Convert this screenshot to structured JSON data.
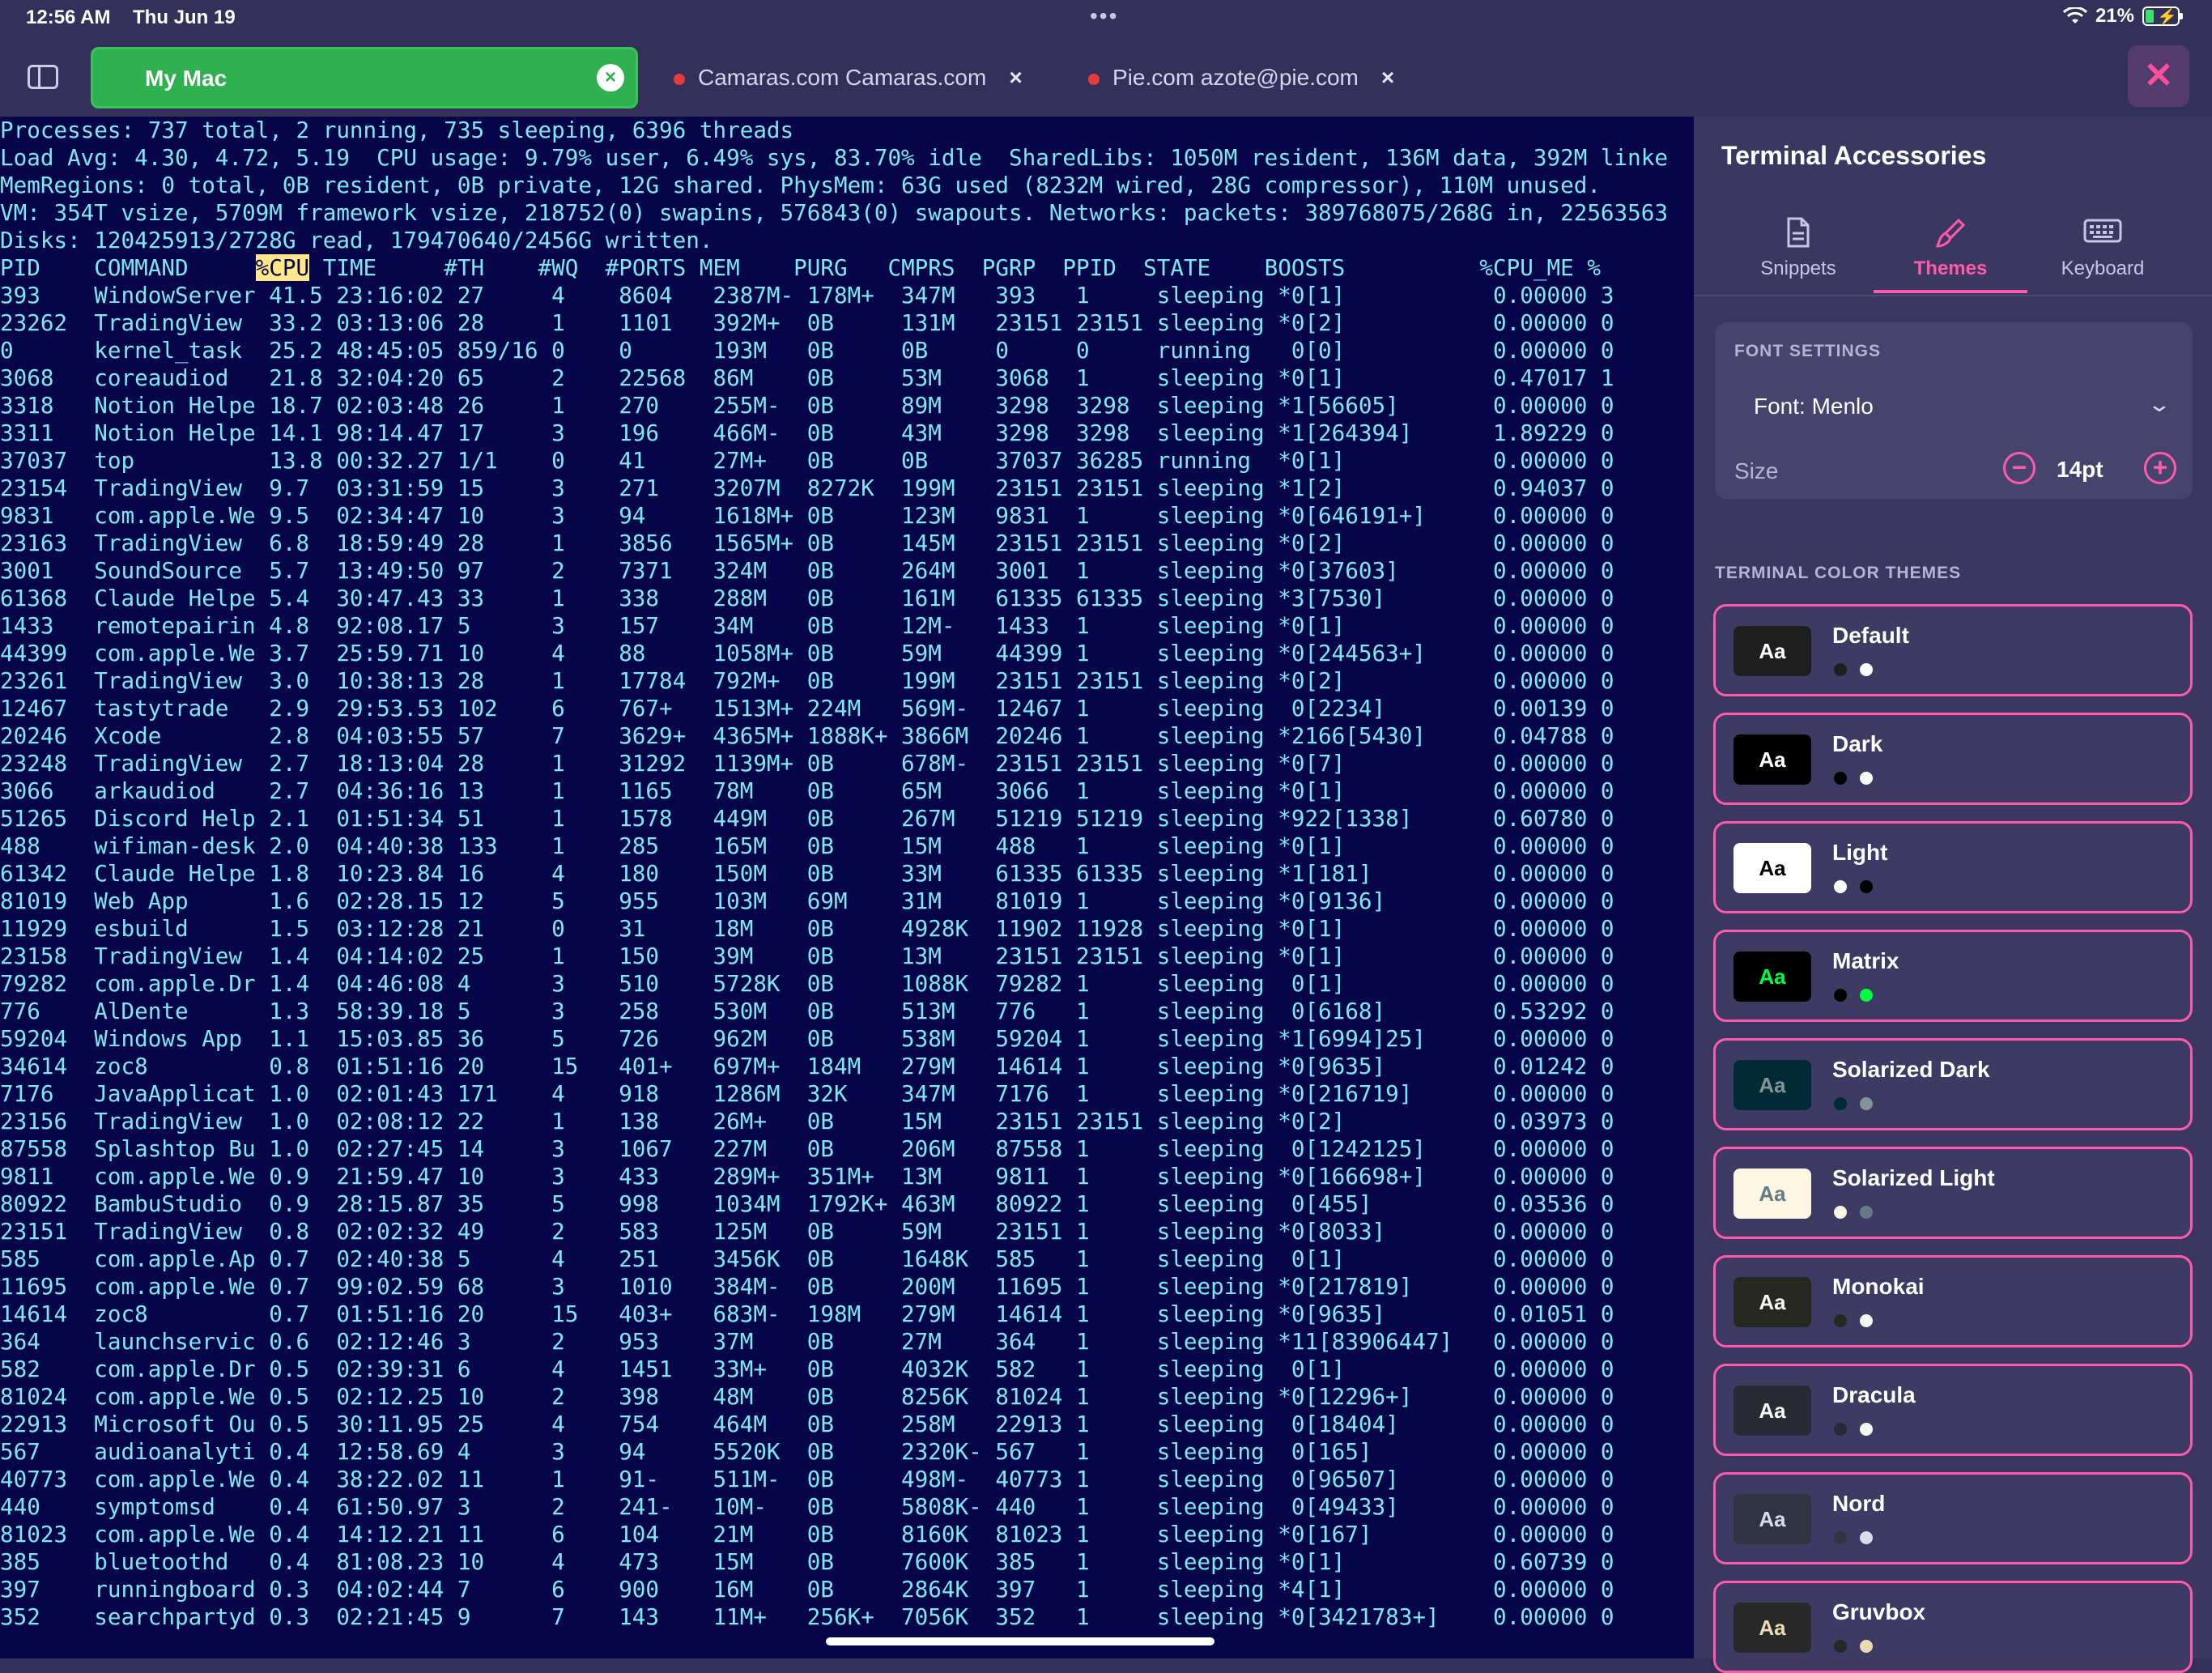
{
  "status_bar": {
    "time": "12:56 AM",
    "date": "Thu Jun 19",
    "battery": "21%",
    "menu_dots": "•••"
  },
  "tabs": {
    "active": {
      "label": "My Mac",
      "close": "×"
    },
    "others": [
      {
        "label": "Camaras.com Camaras.com",
        "close": "×"
      },
      {
        "label": "Pie.com azote@pie.com",
        "close": "×"
      }
    ],
    "close_panel": "✕"
  },
  "terminal": {
    "header": [
      "Processes: 737 total, 2 running, 735 sleeping, 6396 threads",
      "Load Avg: 4.30, 4.72, 5.19  CPU usage: 9.79% user, 6.49% sys, 83.70% idle  SharedLibs: 1050M resident, 136M data, 392M linke",
      "MemRegions: 0 total, 0B resident, 0B private, 12G shared. PhysMem: 63G used (8232M wired, 28G compressor), 110M unused.",
      "VM: 354T vsize, 5709M framework vsize, 218752(0) swapins, 576843(0) swapouts. Networks: packets: 389768075/268G in, 22563563",
      "Disks: 120425913/2728G read, 179470640/2456G written.",
      ""
    ],
    "column_prefix": "PID    COMMAND     ",
    "column_highlight": "%CPU",
    "column_suffix": " TIME     #TH    #WQ  #PORTS MEM    PURG   CMPRS  PGRP  PPID  STATE    BOOSTS          %CPU_ME %",
    "rows": [
      "393    WindowServer 41.5 23:16:02 27     4    8604   2387M- 178M+  347M   393   1     sleeping *0[1]           0.00000 3",
      "23262  TradingView  33.2 03:13:06 28     1    1101   392M+  0B     131M   23151 23151 sleeping *0[2]           0.00000 0",
      "0      kernel_task  25.2 48:45:05 859/16 0    0      193M   0B     0B     0     0     running   0[0]           0.00000 0",
      "3068   coreaudiod   21.8 32:04:20 65     2    22568  86M    0B     53M    3068  1     sleeping *0[1]           0.47017 1",
      "3318   Notion Helpe 18.7 02:03:48 26     1    270    255M-  0B     89M    3298  3298  sleeping *1[56605]       0.00000 0",
      "3311   Notion Helpe 14.1 98:14.47 17     3    196    466M-  0B     43M    3298  3298  sleeping *1[264394]      1.89229 0",
      "37037  top          13.8 00:32.27 1/1    0    41     27M+   0B     0B     37037 36285 running  *0[1]           0.00000 0",
      "23154  TradingView  9.7  03:31:59 15     3    271    3207M  8272K  199M   23151 23151 sleeping *1[2]           0.94037 0",
      "9831   com.apple.We 9.5  02:34:47 10     3    94     1618M+ 0B     123M   9831  1     sleeping *0[646191+]     0.00000 0",
      "23163  TradingView  6.8  18:59:49 28     1    3856   1565M+ 0B     145M   23151 23151 sleeping *0[2]           0.00000 0",
      "3001   SoundSource  5.7  13:49:50 97     2    7371   324M   0B     264M   3001  1     sleeping *0[37603]       0.00000 0",
      "61368  Claude Helpe 5.4  30:47.43 33     1    338    288M   0B     161M   61335 61335 sleeping *3[7530]        0.00000 0",
      "1433   remotepairin 4.8  92:08.17 5      3    157    34M    0B     12M-   1433  1     sleeping *0[1]           0.00000 0",
      "44399  com.apple.We 3.7  25:59.71 10     4    88     1058M+ 0B     59M    44399 1     sleeping *0[244563+]     0.00000 0",
      "23261  TradingView  3.0  10:38:13 28     1    17784  792M+  0B     199M   23151 23151 sleeping *0[2]           0.00000 0",
      "12467  tastytrade   2.9  29:53.53 102    6    767+   1513M+ 224M   569M-  12467 1     sleeping  0[2234]        0.00139 0",
      "20246  Xcode        2.8  04:03:55 57     7    3629+  4365M+ 1888K+ 3866M  20246 1     sleeping *2166[5430]     0.04788 0",
      "23248  TradingView  2.7  18:13:04 28     1    31292  1139M+ 0B     678M-  23151 23151 sleeping *0[7]           0.00000 0",
      "3066   arkaudiod    2.7  04:36:16 13     1    1165   78M    0B     65M    3066  1     sleeping *0[1]           0.00000 0",
      "51265  Discord Help 2.1  01:51:34 51     1    1578   449M   0B     267M   51219 51219 sleeping *922[1338]      0.60780 0",
      "488    wifiman-desk 2.0  04:40:38 133    1    285    165M   0B     15M    488   1     sleeping *0[1]           0.00000 0",
      "61342  Claude Helpe 1.8  10:23.84 16     4    180    150M   0B     33M    61335 61335 sleeping *1[181]         0.00000 0",
      "81019  Web App      1.6  02:28.15 12     5    955    103M   69M    31M    81019 1     sleeping *0[9136]        0.00000 0",
      "11929  esbuild      1.5  03:12:28 21     0    31     18M    0B     4928K  11902 11928 sleeping *0[1]           0.00000 0",
      "23158  TradingView  1.4  04:14:02 25     1    150    39M    0B     13M    23151 23151 sleeping *0[1]           0.00000 0",
      "79282  com.apple.Dr 1.4  04:46:08 4      3    510    5728K  0B     1088K  79282 1     sleeping  0[1]           0.00000 0",
      "776    AlDente      1.3  58:39.18 5      3    258    530M   0B     513M   776   1     sleeping  0[6168]        0.53292 0",
      "59204  Windows App  1.1  15:03.85 36     5    726    962M   0B     538M   59204 1     sleeping *1[6994]25]     0.00000 0",
      "34614  zoc8         0.8  01:51:16 20     15   401+   697M+  184M   279M   14614 1     sleeping *0[9635]        0.01242 0",
      "7176   JavaApplicat 1.0  02:01:43 171    4    918    1286M  32K    347M   7176  1     sleeping *0[216719]      0.00000 0",
      "23156  TradingView  1.0  02:08:12 22     1    138    26M+   0B     15M    23151 23151 sleeping *0[2]           0.03973 0",
      "87558  Splashtop Bu 1.0  02:27:45 14     3    1067   227M   0B     206M   87558 1     sleeping  0[1242125]     0.00000 0",
      "9811   com.apple.We 0.9  21:59.47 10     3    433    289M+  351M+  13M    9811  1     sleeping *0[166698+]     0.00000 0",
      "80922  BambuStudio  0.9  28:15.87 35     5    998    1034M  1792K+ 463M   80922 1     sleeping  0[455]         0.03536 0",
      "23151  TradingView  0.8  02:02:32 49     2    583    125M   0B     59M    23151 1     sleeping *0[8033]        0.00000 0",
      "585    com.apple.Ap 0.7  02:40:38 5      4    251    3456K  0B     1648K  585   1     sleeping  0[1]           0.00000 0",
      "11695  com.apple.We 0.7  99:02.59 68     3    1010   384M-  0B     200M   11695 1     sleeping *0[217819]      0.00000 0",
      "14614  zoc8         0.7  01:51:16 20     15   403+   683M-  198M   279M   14614 1     sleeping *0[9635]        0.01051 0",
      "364    launchservic 0.6  02:12:46 3      2    953    37M    0B     27M    364   1     sleeping *11[83906447]   0.00000 0",
      "582    com.apple.Dr 0.5  02:39:31 6      4    1451   33M+   0B     4032K  582   1     sleeping  0[1]           0.00000 0",
      "81024  com.apple.We 0.5  02:12.25 10     2    398    48M    0B     8256K  81024 1     sleeping *0[12296+]      0.00000 0",
      "22913  Microsoft Ou 0.5  30:11.95 25     4    754    464M   0B     258M   22913 1     sleeping  0[18404]       0.00000 0",
      "567    audioanalyti 0.4  12:58.69 4      3    94     5520K  0B     2320K- 567   1     sleeping  0[165]         0.00000 0",
      "40773  com.apple.We 0.4  38:22.02 11     1    91-    511M-  0B     498M-  40773 1     sleeping  0[96507]       0.00000 0",
      "440    symptomsd    0.4  61:50.97 3      2    241-   10M-   0B     5808K- 440   1     sleeping  0[49433]       0.00000 0",
      "81023  com.apple.We 0.4  14:12.21 11     6    104    21M    0B     8160K  81023 1     sleeping *0[167]         0.00000 0",
      "385    bluetoothd   0.4  81:08.23 10     4    473    15M    0B     7600K  385   1     sleeping *0[1]           0.60739 0",
      "397    runningboard 0.3  04:02:44 7      6    900    16M    0B     2864K  397   1     sleeping *4[1]           0.00000 0",
      "352    searchpartyd 0.3  02:21:45 9      7    143    11M+   256K+  7056K  352   1     sleeping *0[3421783+]    0.00000 0"
    ]
  },
  "panel": {
    "title": "Terminal Accessories",
    "tabs": [
      {
        "label": "Snippets",
        "icon": "document-icon"
      },
      {
        "label": "Themes",
        "icon": "brush-icon"
      },
      {
        "label": "Keyboard",
        "icon": "keyboard-icon"
      }
    ],
    "font_settings": {
      "heading": "FONT SETTINGS",
      "font_label": "Font: Menlo",
      "size_label": "Size",
      "size_value": "14pt",
      "decrease": "−",
      "increase": "+"
    },
    "themes_heading": "TERMINAL COLOR THEMES",
    "swatch_text": "Aa",
    "themes": [
      {
        "name": "Default",
        "bg": "#1e1e1e",
        "fg": "#ffffff",
        "dot1": "#1e1e1e",
        "dot2": "#ffffff"
      },
      {
        "name": "Dark",
        "bg": "#000000",
        "fg": "#ffffff",
        "dot1": "#000000",
        "dot2": "#ffffff"
      },
      {
        "name": "Light",
        "bg": "#ffffff",
        "fg": "#000000",
        "dot1": "#ffffff",
        "dot2": "#000000"
      },
      {
        "name": "Matrix",
        "bg": "#000000",
        "fg": "#00ff41",
        "dot1": "#000000",
        "dot2": "#00ff41"
      },
      {
        "name": "Solarized Dark",
        "bg": "#002b36",
        "fg": "#839496",
        "dot1": "#002b36",
        "dot2": "#839496"
      },
      {
        "name": "Solarized Light",
        "bg": "#fdf6e3",
        "fg": "#657b83",
        "dot1": "#fdf6e3",
        "dot2": "#657b83"
      },
      {
        "name": "Monokai",
        "bg": "#272822",
        "fg": "#f8f8f2",
        "dot1": "#272822",
        "dot2": "#f8f8f2"
      },
      {
        "name": "Dracula",
        "bg": "#282a36",
        "fg": "#f8f8f2",
        "dot1": "#282a36",
        "dot2": "#f8f8f2"
      },
      {
        "name": "Nord",
        "bg": "#2e3440",
        "fg": "#d8dee9",
        "dot1": "#2e3440",
        "dot2": "#d8dee9"
      },
      {
        "name": "Gruvbox",
        "bg": "#282828",
        "fg": "#ebdbb2",
        "dot1": "#282828",
        "dot2": "#ebdbb2"
      }
    ]
  }
}
